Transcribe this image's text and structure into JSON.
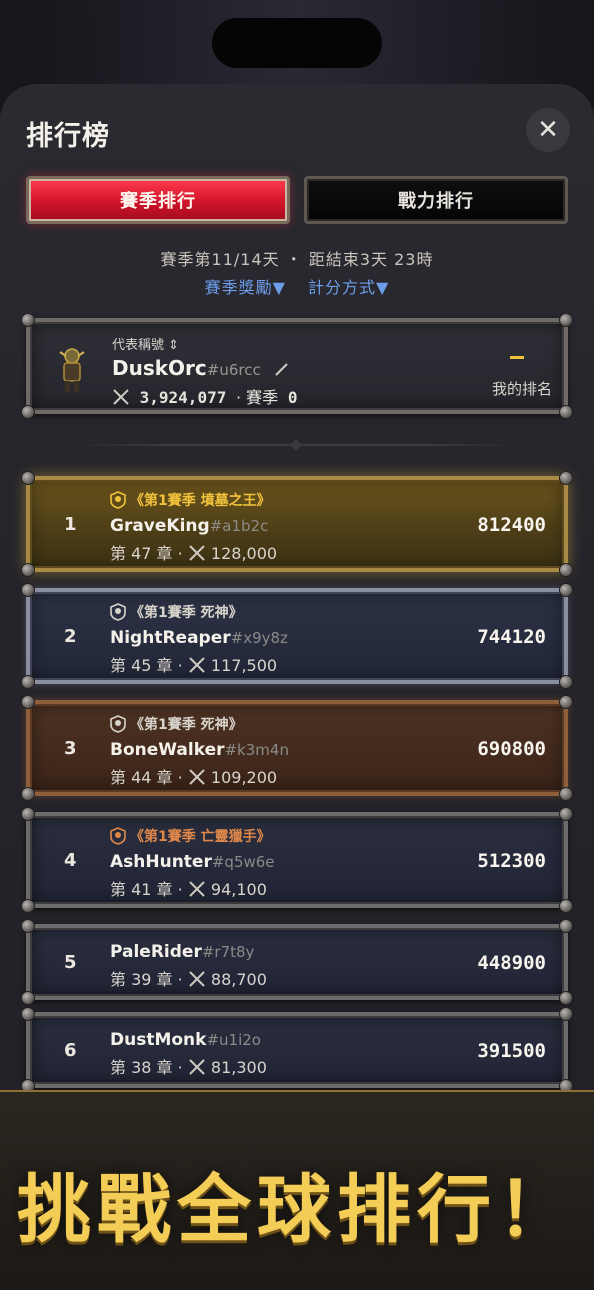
{
  "header": {
    "title": "排行榜"
  },
  "tabs": [
    {
      "label": "賽季排行",
      "active": true
    },
    {
      "label": "戰力排行",
      "active": false
    }
  ],
  "season": {
    "progress_text": "賽季第11/14天 ・ 距結束3天 23時",
    "rewards_link": "賽季獎勵▼",
    "scoring_link": "計分方式▼"
  },
  "me": {
    "title_label": "代表稱號 ⇕",
    "name": "DuskOrc",
    "tag": "#u6rcc",
    "power": "3,924,077",
    "season_label": "· 賽季",
    "season_score": "0",
    "rank_label": "我的排名"
  },
  "leaderboard": [
    {
      "rank": "1",
      "title": "《第1賽季 墳墓之王》",
      "title_color": "#f1c23c",
      "name": "GraveKing",
      "tag": "#a1b2c",
      "chapter": "第 47 章 ·",
      "power": "128,000",
      "score": "812400",
      "style": "gold"
    },
    {
      "rank": "2",
      "title": "《第1賽季 死神》",
      "title_color": "#d8d4cc",
      "name": "NightReaper",
      "tag": "#x9y8z",
      "chapter": "第 45 章 ·",
      "power": "117,500",
      "score": "744120",
      "style": "silver"
    },
    {
      "rank": "3",
      "title": "《第1賽季 死神》",
      "title_color": "#d8d4cc",
      "name": "BoneWalker",
      "tag": "#k3m4n",
      "chapter": "第 44 章 ·",
      "power": "109,200",
      "score": "690800",
      "style": "bronze"
    },
    {
      "rank": "4",
      "title": "《第1賽季 亡靈獵手》",
      "title_color": "#e0884a",
      "name": "AshHunter",
      "tag": "#q5w6e",
      "chapter": "第 41 章 ·",
      "power": "94,100",
      "score": "512300",
      "style": "plain"
    },
    {
      "rank": "5",
      "title": "",
      "title_color": "",
      "name": "PaleRider",
      "tag": "#r7t8y",
      "chapter": "第 39 章 ·",
      "power": "88,700",
      "score": "448900",
      "style": "plain"
    },
    {
      "rank": "6",
      "title": "",
      "title_color": "",
      "name": "DustMonk",
      "tag": "#u1i2o",
      "chapter": "第 38 章 ·",
      "power": "81,300",
      "score": "391500",
      "style": "plain"
    }
  ],
  "banner": {
    "text": "挑戰全球排行！"
  },
  "icons": {
    "close": "close-icon",
    "sword": "crossed-swords-icon",
    "edit": "pencil-icon",
    "skull": "skull-badge-icon"
  },
  "colors": {
    "accent_red": "#d0142a",
    "gold": "#f4cd57",
    "link_blue": "#6d9de8"
  }
}
